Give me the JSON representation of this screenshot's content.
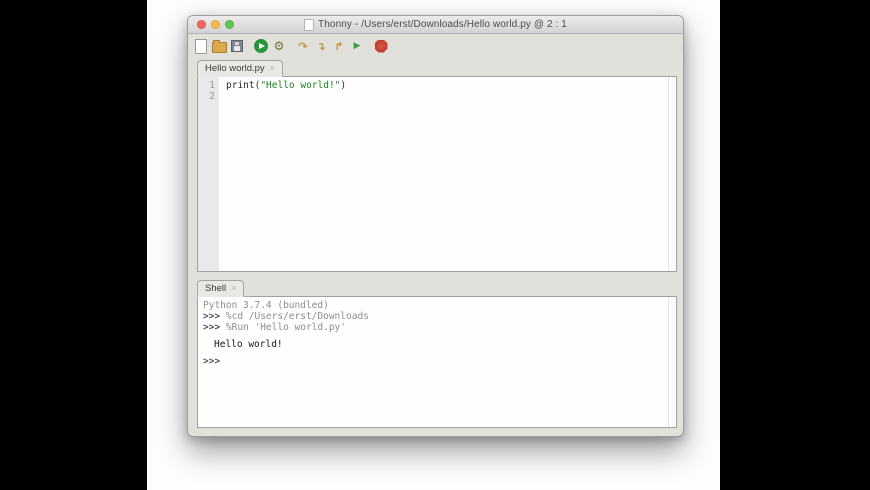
{
  "window": {
    "title": "Thonny - /Users/erst/Downloads/Hello world.py @ 2 : 1"
  },
  "toolbar": {
    "icons": [
      "new-file",
      "open-file",
      "save-file",
      "run-script",
      "debug-script",
      "step-over",
      "step-into",
      "step-out",
      "resume",
      "stop-restart"
    ]
  },
  "editor": {
    "tab_label": "Hello world.py",
    "tab_close": "×",
    "line_numbers": [
      "1",
      "2"
    ],
    "code": {
      "part_before": "print(",
      "string": "\"Hello world!\"",
      "part_after": ")"
    }
  },
  "shell": {
    "tab_label": "Shell",
    "tab_close": "×",
    "banner": "Python 3.7.4 (bundled)",
    "prompt": ">>>",
    "command_cd": "%cd /Users/erst/Downloads",
    "command_run": "%Run 'Hello world.py'",
    "output": "Hello world!"
  },
  "colors": {
    "string_green": "#1e8022",
    "shell_muted": "#8e8e8e",
    "shell_output": "#161616",
    "run_green": "#28943c",
    "stop_red": "#c13a2c",
    "step_tan": "#c1933f"
  }
}
